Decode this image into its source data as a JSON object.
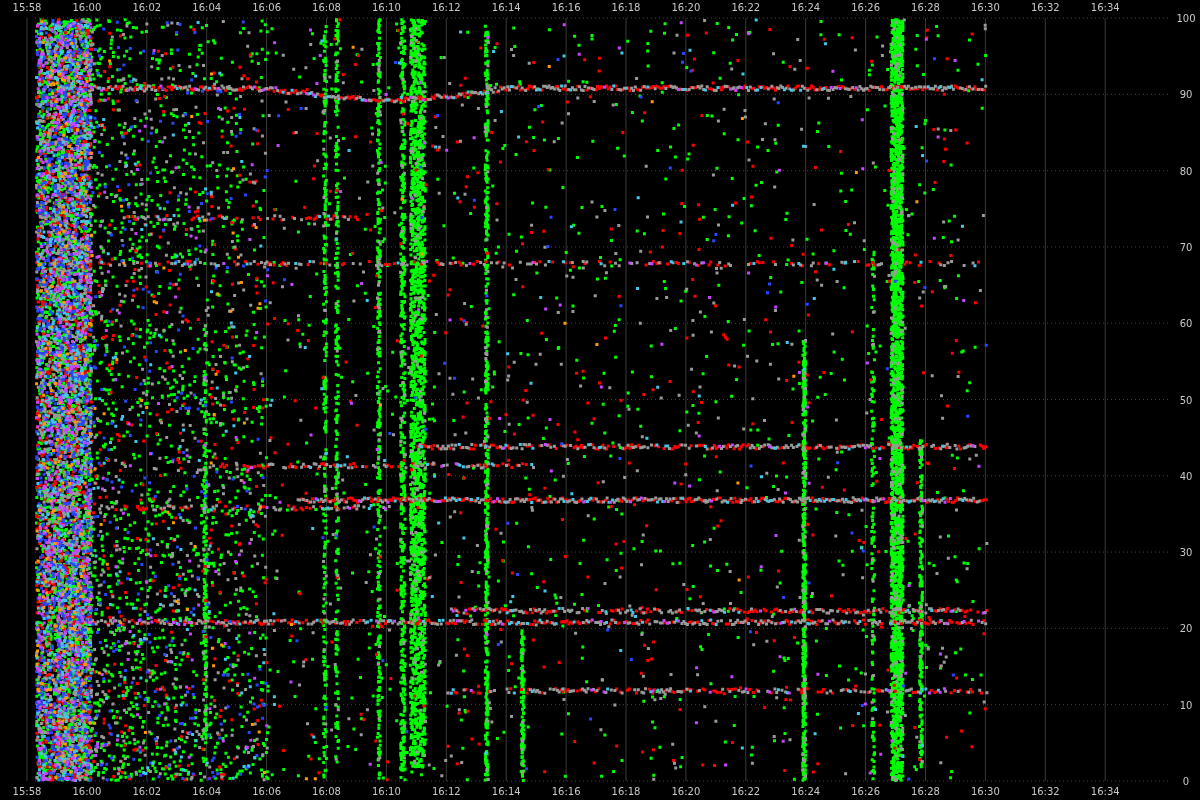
{
  "chart": {
    "top_axis_labels": [
      "15:58",
      "16:00",
      "16:02",
      "16:04",
      "16:06",
      "16:08",
      "16:10",
      "16:12",
      "16:14",
      "16:16",
      "16:18",
      "16:20",
      "16:22",
      "16:24",
      "16:26",
      "16:28",
      "16:30",
      "16:32",
      "16:34"
    ],
    "bottom_axis_labels": [
      "15:58",
      "16:00",
      "16:02",
      "16:04",
      "16:06",
      "16:08",
      "16:10",
      "16:12",
      "16:14",
      "16:16",
      "16:18",
      "16:20",
      "16:22",
      "16:24",
      "16:26",
      "16:28",
      "16:30",
      "16:32",
      "16:34"
    ],
    "right_axis_labels": [
      "100",
      "90",
      "80",
      "70",
      "60",
      "50",
      "40",
      "30",
      "20",
      "10",
      "0"
    ]
  }
}
